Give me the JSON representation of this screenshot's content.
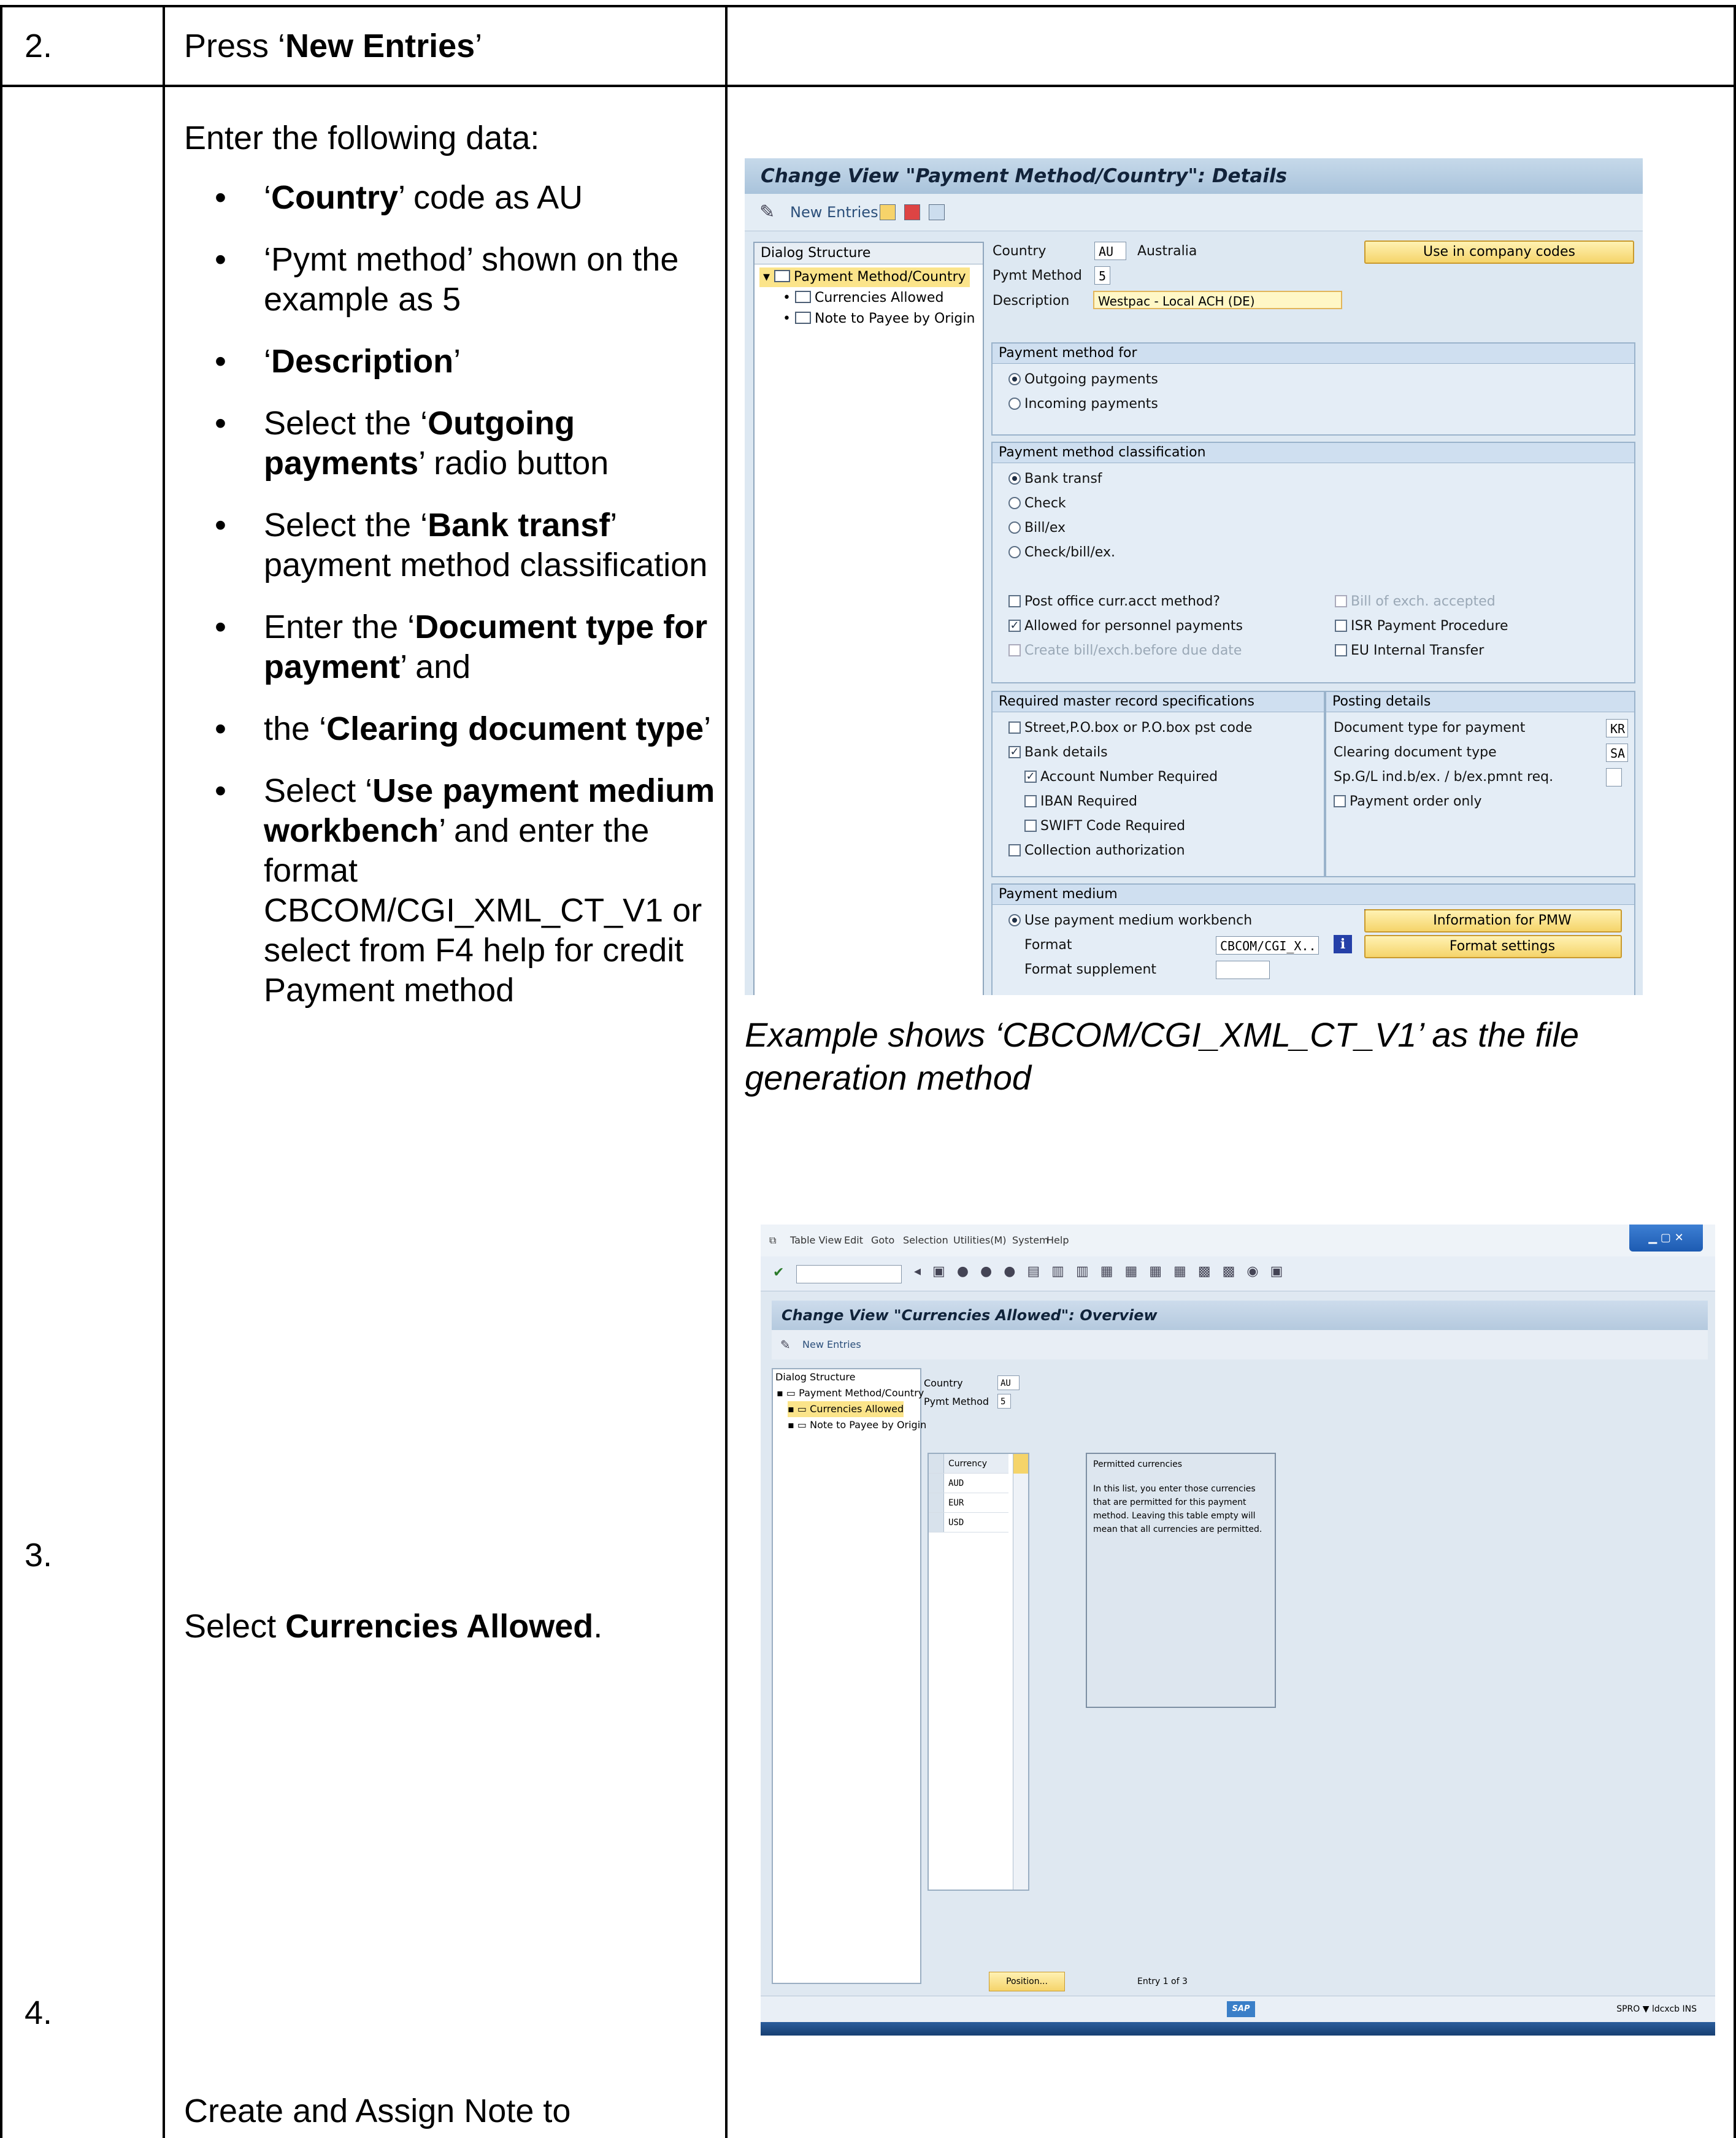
{
  "row2": {
    "number": "2.",
    "text_pre": "Press ‘",
    "text_bold": "New Entries",
    "text_post": "’"
  },
  "row3": {
    "number": "3.",
    "intro": "Enter the following data:",
    "bullets": [
      {
        "pre": "‘",
        "bold": "Country",
        "post": "’ code as AU"
      },
      {
        "pre": "‘Pymt method’ shown on the example as 5",
        "bold": "",
        "post": ""
      },
      {
        "pre": "‘",
        "bold": "Description",
        "post": "’"
      },
      {
        "pre": "Select the ‘",
        "bold": "Outgoing payments",
        "post": "’ radio button"
      },
      {
        "pre": "Select the ‘",
        "bold": "Bank transf",
        "post": "’ payment method classification"
      },
      {
        "pre": "Enter the ‘",
        "bold": "Document type for payment",
        "post": "’ and"
      },
      {
        "pre": "the ‘",
        "bold": "Clearing document type",
        "post": "’"
      },
      {
        "pre": "Select ‘",
        "bold": "Use payment medium workbench",
        "post": "’ and enter the format CBCOM/CGI_XML_CT_V1 or select from F4 help for credit Payment method"
      }
    ],
    "caption": "Example shows ‘CBCOM/CGI_XML_CT_V1’ as the file generation method"
  },
  "row4": {
    "number": "4.",
    "text_pre": "Select ",
    "text_bold": "Currencies Allowed",
    "text_post": "."
  },
  "row5": {
    "text": "Create and  Assign Note to"
  },
  "screen1": {
    "title": "Change View \"Payment Method/Country\": Details",
    "toolbar_new_entries": "New Entries",
    "dialog_structure": "Dialog Structure",
    "tree": [
      "Payment Method/Country",
      "Currencies Allowed",
      "Note to Payee by Origin"
    ],
    "country_label": "Country",
    "country_value": "AU",
    "country_name": "Australia",
    "use_in_company_codes": "Use in company codes",
    "pymt_method_label": "Pymt Method",
    "pymt_method_value": "5",
    "description_label": "Description",
    "description_value": "Westpac - Local ACH (DE)",
    "group_payment_for": "Payment method for",
    "outgoing": "Outgoing payments",
    "incoming": "Incoming payments",
    "group_classification": "Payment method classification",
    "class_options": [
      "Bank transf",
      "Check",
      "Bill/ex",
      "Check/bill/ex."
    ],
    "post_office": "Post office curr.acct method?",
    "allowed_personnel": "Allowed for personnel payments",
    "create_bill": "Create bill/exch.before due date",
    "bill_accepted": "Bill of exch. accepted",
    "isr": "ISR Payment Procedure",
    "eu_transfer": "EU Internal Transfer",
    "group_required": "Required master record specifications",
    "street": "Street,P.O.box or P.O.box pst code",
    "bank_details": "Bank details",
    "account_number": "Account Number Required",
    "iban": "IBAN Required",
    "swift": "SWIFT Code Required",
    "collection": "Collection authorization",
    "group_posting": "Posting details",
    "doc_type_label": "Document type for payment",
    "doc_type_value": "KR",
    "clearing_label": "Clearing document type",
    "clearing_value": "SA",
    "spgl_label": "Sp.G/L ind.b/ex. / b/ex.pmnt req.",
    "payment_order": "Payment order only",
    "group_medium": "Payment medium",
    "use_pmw": "Use payment medium workbench",
    "info_pmw": "Information for PMW",
    "format_label": "Format",
    "format_value": "CBCOM/CGI_X..",
    "format_settings": "Format settings",
    "format_supplement": "Format supplement"
  },
  "screen2": {
    "menu": [
      "Table View",
      "Edit",
      "Goto",
      "Selection",
      "Utilities(M)",
      "System",
      "Help"
    ],
    "title": "Change View \"Currencies Allowed\": Overview",
    "toolbar_new_entries": "New Entries",
    "dialog_structure": "Dialog Structure",
    "tree": [
      "Payment Method/Country",
      "Currencies Allowed",
      "Note to Payee by Origin"
    ],
    "country_label": "Country",
    "country_value": "AU",
    "pymt_label": "Pymt Method",
    "pymt_value": "5",
    "col_currency": "Currency",
    "currencies": [
      "AUD",
      "EUR",
      "USD"
    ],
    "popup_title": "Permitted currencies",
    "popup_text": "In this list, you enter those currencies that are permitted for this payment method. Leaving this table empty will mean that all currencies are permitted.",
    "position_btn": "Position...",
    "entry_text": "Entry 1 of 3",
    "status_right": "SPRO ▼  ldcxcb  INS"
  }
}
